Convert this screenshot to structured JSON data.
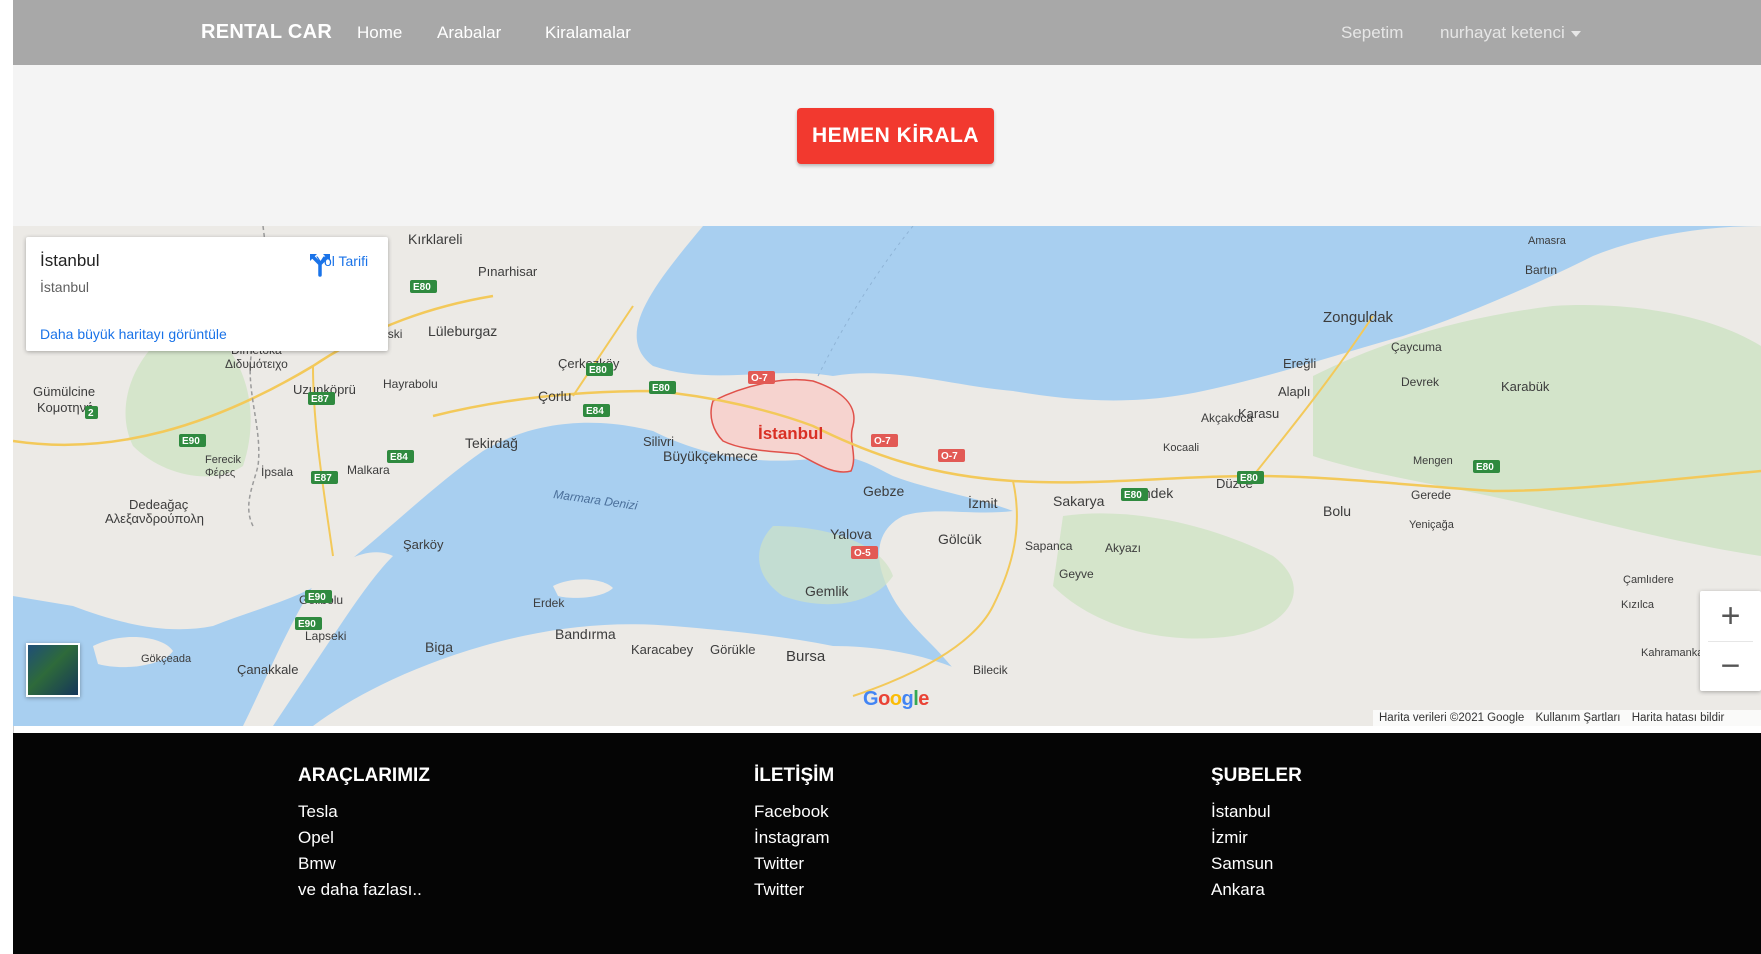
{
  "navbar": {
    "brand": "RENTAL CAR",
    "links": [
      "Home",
      "Arabalar",
      "Kiralamalar"
    ],
    "cart": "Sepetim",
    "user": "nurhayat ketenci"
  },
  "hero": {
    "cta_label": "HEMEN KİRALA",
    "cta_color": "#f2392f"
  },
  "map": {
    "place_title": "İstanbul",
    "place_subtitle": "İstanbul",
    "directions_label": "Yol Tarifi",
    "larger_map_link": "Daha büyük haritayı görüntüle",
    "zoom_in": "+",
    "zoom_out": "−",
    "google_logo": "Google",
    "attribution": [
      "Harita verileri ©2021 Google",
      "Kullanım Şartları",
      "Harita hatası bildir"
    ],
    "sea_label": "Marmara Denizi",
    "cities": [
      "Kırklareli",
      "Pınarhisar",
      "Lüleburgaz",
      "Babaeski",
      "Dimetoka",
      "Διδυμότειχο",
      "Gümülcine",
      "Κομοτηνή",
      "Uzunköprü",
      "Hayrabolu",
      "Çerkezköy",
      "Çorlu",
      "Tekirdağ",
      "Silivri",
      "Büyükçekmece",
      "İstanbul",
      "Gebze",
      "İzmit",
      "Sakarya",
      "Hendek",
      "Düzce",
      "Bolu",
      "Karasu",
      "Akçakoca",
      "Kocaali",
      "Ereğli",
      "Alaplı",
      "Zonguldak",
      "Çaycuma",
      "Devrek",
      "Karabük",
      "Bartın",
      "Amasra",
      "Mengen",
      "Gerede",
      "Yeniçağa",
      "Yalova",
      "Gölcük",
      "Sapanca",
      "Akyazı",
      "Geyve",
      "Gemlik",
      "Bursa",
      "Görükle",
      "Karacabey",
      "Bandırma",
      "Erdek",
      "Biga",
      "Çanakkale",
      "Lapseki",
      "Gelibolu",
      "Gökçeada",
      "Şarköy",
      "Malkara",
      "İpsala",
      "Ferecik",
      "Φέρες",
      "Dedeağaç",
      "Αλεξανδρούπολη",
      "Çamlıdere",
      "Kızılca",
      "Kahramanka",
      "Bilecik"
    ],
    "roads": [
      "E80",
      "E84",
      "E87",
      "E90",
      "O-7",
      "O-5",
      "2"
    ]
  },
  "footer": {
    "columns": [
      {
        "heading": "ARAÇLARIMIZ",
        "items": [
          "Tesla",
          "Opel",
          "Bmw",
          "ve daha fazlası.."
        ]
      },
      {
        "heading": "İLETİŞİM",
        "items": [
          "Facebook",
          "İnstagram",
          "Twitter",
          "Twitter"
        ]
      },
      {
        "heading": "ŞUBELER",
        "items": [
          "İstanbul",
          "İzmir",
          "Samsun",
          "Ankara"
        ]
      }
    ]
  }
}
